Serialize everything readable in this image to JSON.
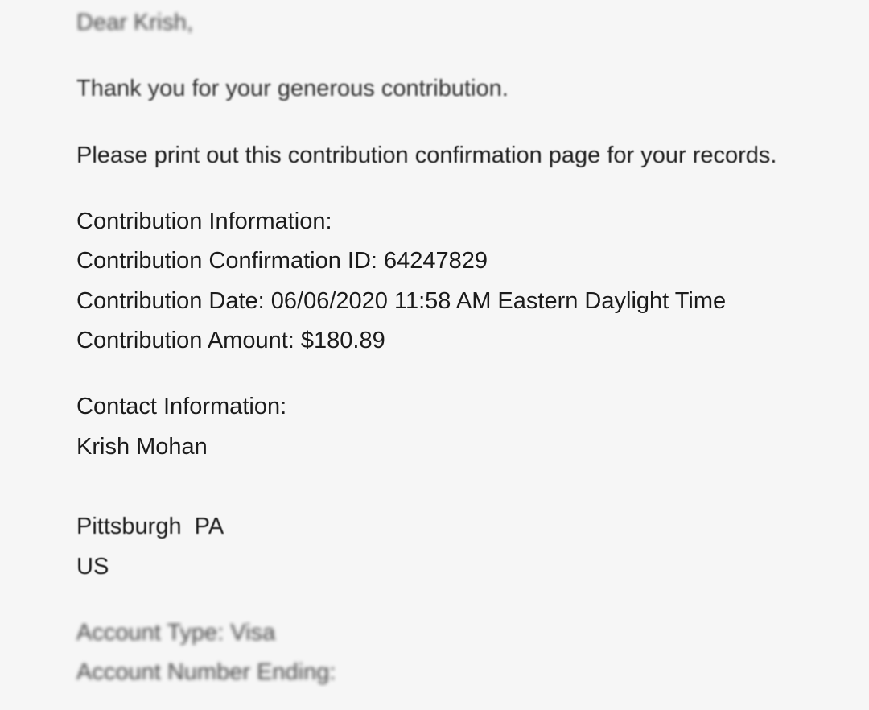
{
  "letter": {
    "greeting": "Dear Krish,",
    "thanks": "Thank you for your generous contribution.",
    "print_note": "Please print out this contribution confirmation page for your records."
  },
  "contribution": {
    "heading": "Contribution Information:",
    "confirmation_id": "Contribution Confirmation ID: 64247829",
    "date": "Contribution Date: 06/06/2020 11:58 AM Eastern Daylight Time",
    "amount": "Contribution Amount: $180.89"
  },
  "contact": {
    "heading": "Contact Information:",
    "name": "Krish Mohan",
    "city_state": "Pittsburgh  PA",
    "country": "US"
  },
  "account": {
    "type": "Account Type: Visa",
    "number_ending": "Account Number Ending:"
  }
}
